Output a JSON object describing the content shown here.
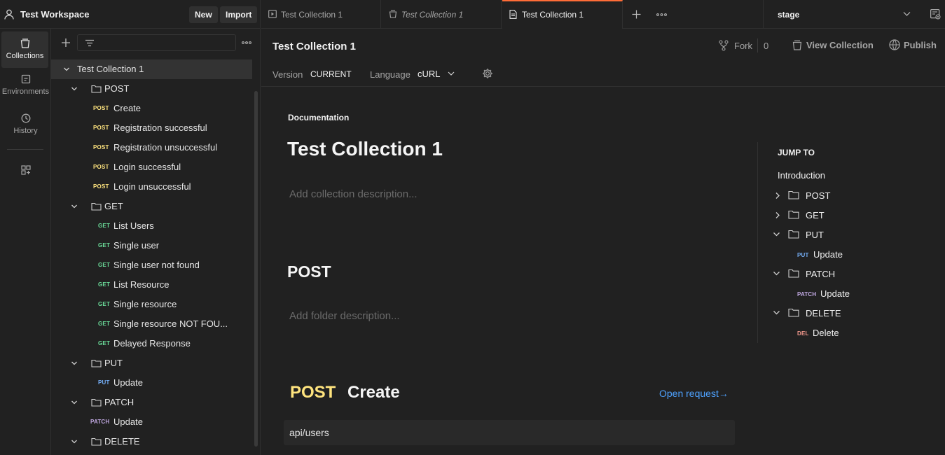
{
  "workspace": {
    "name": "Test Workspace",
    "new_label": "New",
    "import_label": "Import"
  },
  "rail": {
    "items": [
      {
        "label": "Collections",
        "icon": "collections-icon",
        "active": true
      },
      {
        "label": "Environments",
        "icon": "environments-icon",
        "active": false
      },
      {
        "label": "History",
        "icon": "history-icon",
        "active": false
      }
    ]
  },
  "sidebar": {
    "collection": "Test Collection 1",
    "folders": [
      {
        "name": "POST",
        "requests": [
          {
            "method": "POST",
            "name": "Create"
          },
          {
            "method": "POST",
            "name": "Registration successful"
          },
          {
            "method": "POST",
            "name": "Registration unsuccessful"
          },
          {
            "method": "POST",
            "name": "Login successful"
          },
          {
            "method": "POST",
            "name": "Login unsuccessful"
          }
        ]
      },
      {
        "name": "GET",
        "requests": [
          {
            "method": "GET",
            "name": "List Users"
          },
          {
            "method": "GET",
            "name": "Single user"
          },
          {
            "method": "GET",
            "name": "Single user not found"
          },
          {
            "method": "GET",
            "name": "List Resource"
          },
          {
            "method": "GET",
            "name": "Single resource"
          },
          {
            "method": "GET",
            "name": "Single resource NOT FOU..."
          },
          {
            "method": "GET",
            "name": "Delayed Response"
          }
        ]
      },
      {
        "name": "PUT",
        "requests": [
          {
            "method": "PUT",
            "name": "Update"
          }
        ]
      },
      {
        "name": "PATCH",
        "requests": [
          {
            "method": "PATCH",
            "name": "Update"
          }
        ]
      },
      {
        "name": "DELETE",
        "requests": []
      }
    ]
  },
  "tabs": [
    {
      "label": "Test Collection 1",
      "icon": "runner-icon",
      "italic": false,
      "active": false
    },
    {
      "label": "Test Collection 1",
      "icon": "collection-icon",
      "italic": true,
      "active": false
    },
    {
      "label": "Test Collection 1",
      "icon": "document-icon",
      "italic": false,
      "active": true
    }
  ],
  "environment": {
    "selected": "stage"
  },
  "main": {
    "title": "Test Collection 1",
    "fork_label": "Fork",
    "fork_count": "0",
    "view_collection_label": "View Collection",
    "publish_label": "Publish",
    "version_label": "Version",
    "version_value": "CURRENT",
    "language_label": "Language",
    "language_value": "cURL",
    "documentation_label": "Documentation",
    "doc_title": "Test Collection 1",
    "collection_desc_placeholder": "Add collection description...",
    "folder_title": "POST",
    "folder_desc_placeholder": "Add folder description...",
    "request_method": "POST",
    "request_name": "Create",
    "open_request_label": "Open request→",
    "request_url": "api/users"
  },
  "jump_to": {
    "title": "JUMP TO",
    "intro": "Introduction",
    "items": [
      {
        "name": "POST",
        "expanded": false,
        "children": []
      },
      {
        "name": "GET",
        "expanded": false,
        "children": []
      },
      {
        "name": "PUT",
        "expanded": true,
        "children": [
          {
            "method": "PUT",
            "name": "Update"
          }
        ]
      },
      {
        "name": "PATCH",
        "expanded": true,
        "children": [
          {
            "method": "PATCH",
            "name": "Update"
          }
        ]
      },
      {
        "name": "DELETE",
        "expanded": true,
        "children": [
          {
            "method": "DEL",
            "name": "Delete"
          }
        ]
      }
    ]
  },
  "colors": {
    "accent": "#ff6c37",
    "post": "#ffe47e",
    "get": "#6bdd9a",
    "put": "#74aef6",
    "patch": "#c0a8e1",
    "delete": "#f79a8e",
    "link": "#4ea2ff"
  }
}
